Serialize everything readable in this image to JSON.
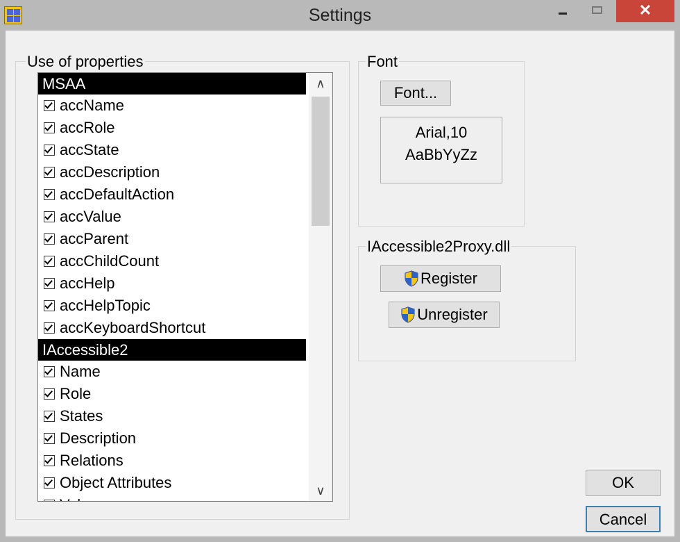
{
  "window": {
    "title": "Settings",
    "close_glyph": "✕",
    "icons": {
      "app": "app-grid-icon",
      "minimize": "minimize-icon",
      "maximize": "maximize-icon",
      "close": "close-icon"
    }
  },
  "properties_group": {
    "label": "Use of properties",
    "list": {
      "msaa_header": "MSAA",
      "msaa_items": [
        "accName",
        "accRole",
        "accState",
        "accDescription",
        "accDefaultAction",
        "accValue",
        "accParent",
        "accChildCount",
        "accHelp",
        "accHelpTopic",
        "accKeyboardShortcut"
      ],
      "ia2_header": "IAccessible2",
      "ia2_items": [
        "Name",
        "Role",
        "States",
        "Description",
        "Relations",
        "Object Attributes",
        "Value"
      ],
      "all_checked": true
    },
    "scroll_up_glyph": "∧",
    "scroll_down_glyph": "∨"
  },
  "font_group": {
    "label": "Font",
    "font_button": "Font...",
    "preview_line1": "Arial,10",
    "preview_line2": "AaBbYyZz"
  },
  "proxy_group": {
    "label": "IAccessible2Proxy.dll",
    "register_button": "Register",
    "unregister_button": "Unregister",
    "button_icon": "uac-shield-icon"
  },
  "footer": {
    "ok_button": "OK",
    "cancel_button": "Cancel"
  },
  "colors": {
    "titlebar": "#b9b9b9",
    "close_button": "#c9453a",
    "dialog_bg": "#f0f0f0",
    "list_header_bg": "#000000",
    "button_bg": "#e1e1e1",
    "focus_border": "#3c7fb1"
  }
}
